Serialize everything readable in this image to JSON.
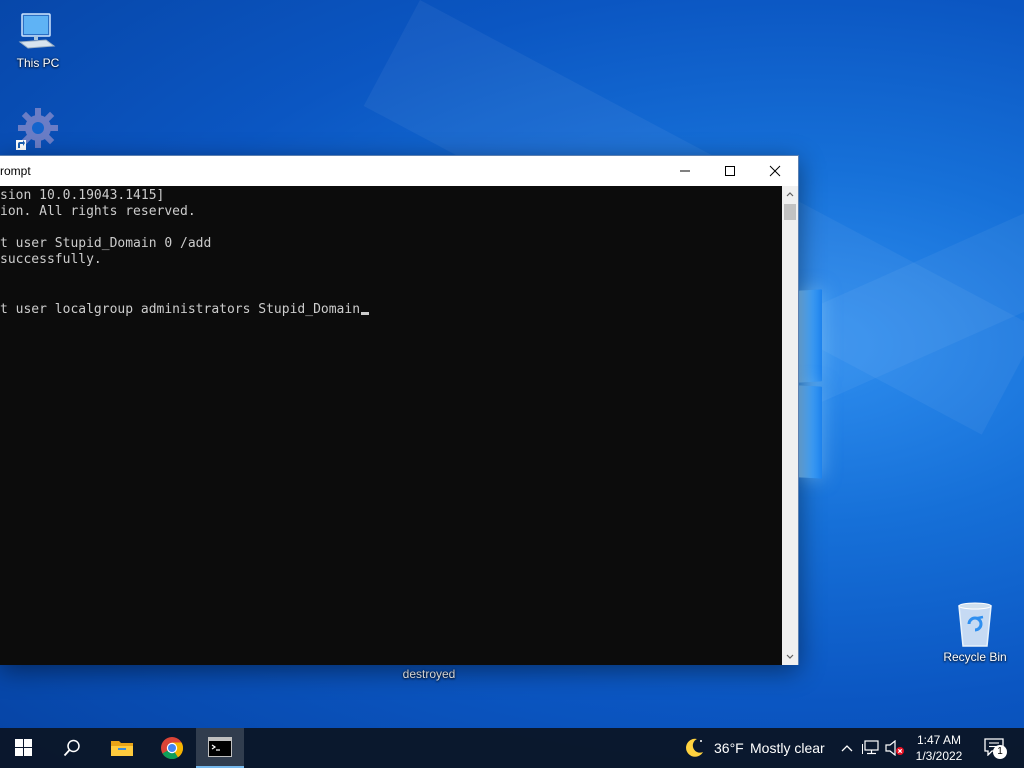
{
  "desktop": {
    "icons": [
      {
        "label": "This PC",
        "icon": "this-pc-icon"
      },
      {
        "label": "",
        "icon": "gear-shortcut-icon"
      },
      {
        "label": "Recycle Bin",
        "icon": "recycle-bin-icon"
      }
    ],
    "hidden_icon_label": "destroyed"
  },
  "window": {
    "title": "rompt",
    "controls": {
      "minimize": "minimize-icon",
      "maximize": "maximize-icon",
      "close": "close-icon"
    },
    "lines": [
      "sion 10.0.19043.1415]",
      "ion. All rights reserved.",
      "",
      "t user Stupid_Domain 0 /add",
      "successfully.",
      "",
      "",
      "t user localgroup administrators Stupid_Domain"
    ],
    "colors": {
      "console_bg": "#0c0c0c",
      "console_fg": "#cccccc"
    }
  },
  "taskbar": {
    "items": [
      "start-icon",
      "search-icon",
      "file-explorer-icon",
      "chrome-icon",
      "command-prompt-icon"
    ],
    "weather": {
      "temp": "36°F",
      "condition": "Mostly clear",
      "icon": "moon-icon"
    },
    "tray_icons": [
      "chevron-up-icon",
      "network-icon",
      "speaker-muted-icon"
    ],
    "clock": {
      "time": "1:47 AM",
      "date": "1/3/2022"
    },
    "notifications": {
      "count": "1",
      "icon": "notification-icon"
    }
  }
}
